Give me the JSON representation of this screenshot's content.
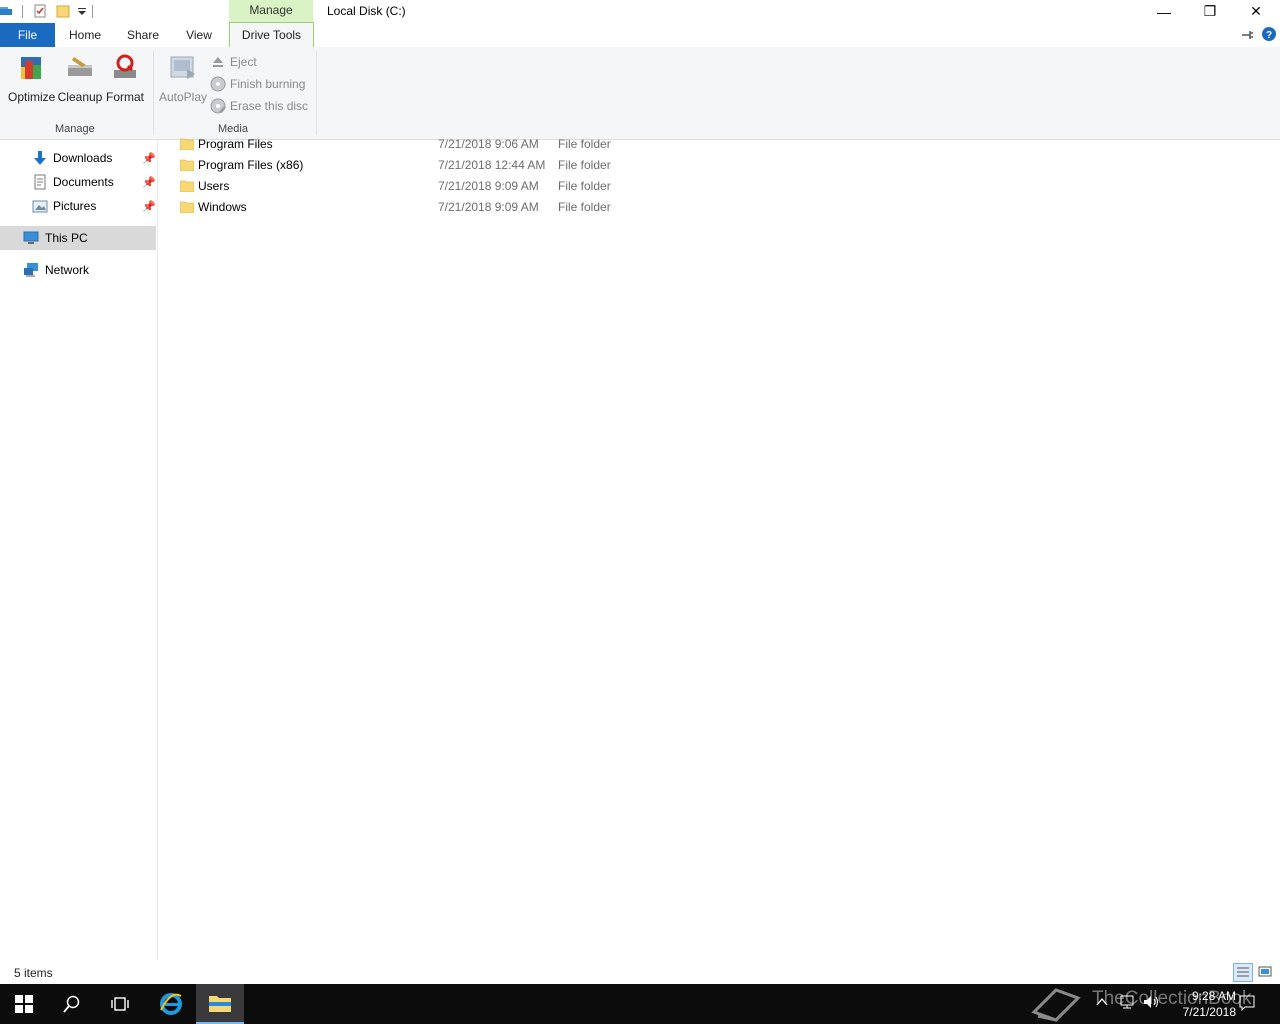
{
  "window": {
    "title": "Local Disk (C:)",
    "context_tab_label": "Manage",
    "minimize_glyph": "—",
    "restore_glyph": "❐",
    "close_glyph": "✕"
  },
  "ribbon_tabs": [
    "File",
    "Home",
    "Share",
    "View",
    "Drive Tools"
  ],
  "ribbon": {
    "manage_group": {
      "label": "Manage",
      "buttons": [
        "Optimize",
        "Cleanup",
        "Format"
      ]
    },
    "media_group": {
      "label": "Media",
      "autoplay_label": "AutoPlay",
      "small_buttons": [
        "Eject",
        "Finish burning",
        "Erase this disc"
      ]
    }
  },
  "nav": {
    "items": [
      {
        "label": "Downloads",
        "icon": "download-arrow-icon",
        "pinned": true
      },
      {
        "label": "Documents",
        "icon": "documents-icon",
        "pinned": true
      },
      {
        "label": "Pictures",
        "icon": "pictures-icon",
        "pinned": true
      },
      {
        "label": "This PC",
        "icon": "computer-icon",
        "pinned": false,
        "selected": true
      },
      {
        "label": "Network",
        "icon": "network-icon",
        "pinned": false
      }
    ]
  },
  "files": [
    {
      "name": "Program Files",
      "date": "7/21/2018 9:06 AM",
      "type": "File folder"
    },
    {
      "name": "Program Files (x86)",
      "date": "7/21/2018 12:44 AM",
      "type": "File folder"
    },
    {
      "name": "Users",
      "date": "7/21/2018 9:09 AM",
      "type": "File folder"
    },
    {
      "name": "Windows",
      "date": "7/21/2018 9:09 AM",
      "type": "File folder"
    }
  ],
  "status": {
    "item_count": "5 items"
  },
  "taskbar": {
    "clock_time": "9:28 AM",
    "clock_date": "7/21/2018",
    "watermark_text": "TheCollectionBook"
  },
  "colors": {
    "file_tab": "#1a6bbf",
    "context_tab": "#d9f3c4",
    "selection": "#d9d9d9",
    "taskbar": "#0c0c0d"
  }
}
